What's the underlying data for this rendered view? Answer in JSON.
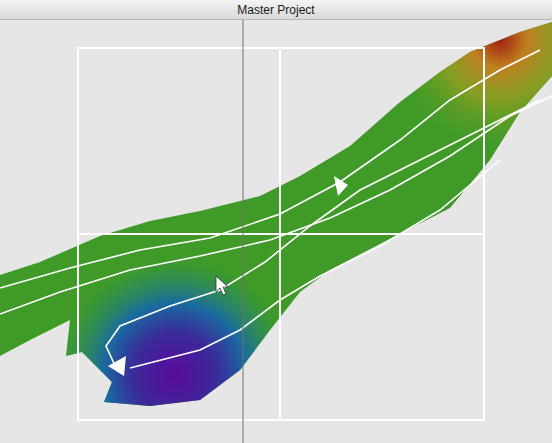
{
  "window": {
    "title": "Master Project"
  }
}
